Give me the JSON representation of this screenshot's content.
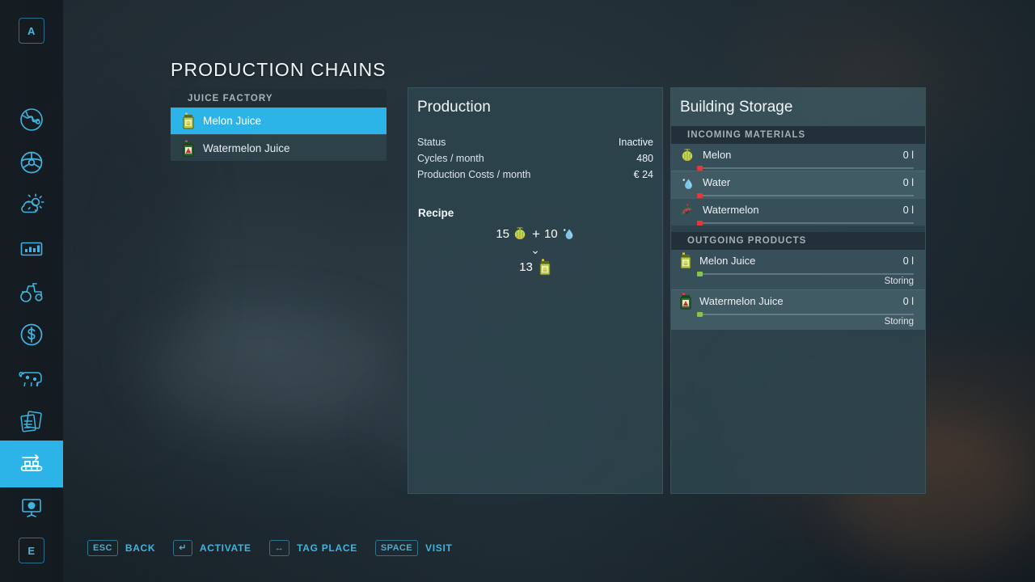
{
  "page": {
    "title": "PRODUCTION CHAINS",
    "accent_color": "#2cb4e8",
    "panel_color": "#2e444d",
    "background_color": "#1d282f"
  },
  "sidebar": {
    "top_key": "A",
    "bottom_key": "E",
    "items": [
      {
        "icon": "globe-map-icon",
        "active": false
      },
      {
        "icon": "steering-wheel-icon",
        "active": false
      },
      {
        "icon": "weather-sun-cloud-icon",
        "active": false
      },
      {
        "icon": "statistics-chart-icon",
        "active": false
      },
      {
        "icon": "tractor-icon",
        "active": false
      },
      {
        "icon": "finances-dollar-icon",
        "active": false
      },
      {
        "icon": "animals-cow-icon",
        "active": false
      },
      {
        "icon": "contracts-papers-icon",
        "active": false
      },
      {
        "icon": "production-conveyor-icon",
        "active": true
      },
      {
        "icon": "presentation-screen-icon",
        "active": false
      }
    ]
  },
  "chain_list": {
    "group_header": "JUICE FACTORY",
    "items": [
      {
        "label": "Melon Juice",
        "icon": "melon-juice-bottle-icon",
        "selected": true
      },
      {
        "label": "Watermelon Juice",
        "icon": "watermelon-juice-bottle-icon",
        "selected": false
      }
    ]
  },
  "production": {
    "title": "Production",
    "stats": [
      {
        "label": "Status",
        "value": "Inactive"
      },
      {
        "label": "Cycles / month",
        "value": "480"
      },
      {
        "label": "Production Costs / month",
        "value": "€ 24"
      }
    ],
    "recipe_title": "Recipe",
    "recipe": {
      "inputs": [
        {
          "amount": "15",
          "icon": "melon-icon",
          "name": "Melon"
        },
        {
          "amount": "10",
          "icon": "water-drop-icon",
          "name": "Water"
        }
      ],
      "plus": "+",
      "arrow": "⌄",
      "outputs": [
        {
          "amount": "13",
          "icon": "melon-juice-bottle-icon",
          "name": "Melon Juice"
        }
      ]
    }
  },
  "storage": {
    "title": "Building Storage",
    "sections": [
      {
        "header": "INCOMING MATERIALS",
        "items": [
          {
            "name": "Melon",
            "amount": "0 l",
            "icon": "melon-icon",
            "fill": 0,
            "dot_color": "#e03a3a",
            "status": ""
          },
          {
            "name": "Water",
            "amount": "0 l",
            "icon": "water-drop-icon",
            "fill": 0,
            "dot_color": "#e03a3a",
            "status": ""
          },
          {
            "name": "Watermelon",
            "amount": "0 l",
            "icon": "watermelon-icon",
            "fill": 0,
            "dot_color": "#e03a3a",
            "status": ""
          }
        ]
      },
      {
        "header": "OUTGOING PRODUCTS",
        "items": [
          {
            "name": "Melon Juice",
            "amount": "0 l",
            "icon": "melon-juice-bottle-icon",
            "fill": 0,
            "dot_color": "#8bc34a",
            "status": "Storing"
          },
          {
            "name": "Watermelon Juice",
            "amount": "0 l",
            "icon": "watermelon-juice-bottle-icon",
            "fill": 0,
            "dot_color": "#8bc34a",
            "status": "Storing"
          }
        ]
      }
    ]
  },
  "hints": [
    {
      "key": "ESC",
      "label": "BACK",
      "icon": "esc-key"
    },
    {
      "key": "↵",
      "label": "ACTIVATE",
      "icon": "enter-key"
    },
    {
      "key": "↔",
      "label": "TAG PLACE",
      "icon": "left-right-arrow-key"
    },
    {
      "key": "SPACE",
      "label": "VISIT",
      "icon": "space-key"
    }
  ]
}
